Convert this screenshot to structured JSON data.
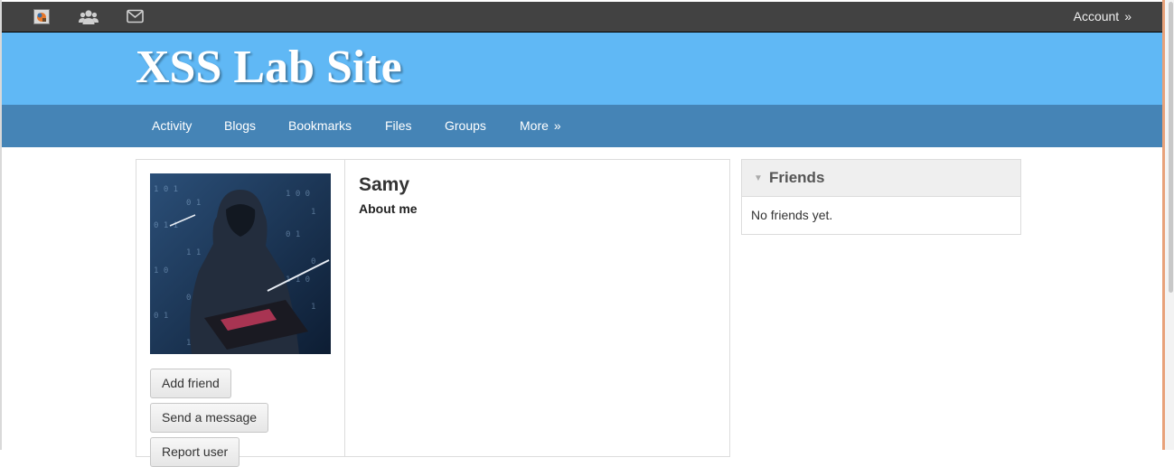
{
  "topbar": {
    "account_label": "Account",
    "account_arrow": "»",
    "icons": [
      "site-logo-icon",
      "friends-icon",
      "mail-icon"
    ]
  },
  "header": {
    "site_title": "XSS Lab Site"
  },
  "nav": {
    "items": [
      "Activity",
      "Blogs",
      "Bookmarks",
      "Files",
      "Groups",
      "More"
    ],
    "more_arrow": "»"
  },
  "profile": {
    "name": "Samy",
    "about_label": "About me",
    "buttons": [
      "Add friend",
      "Send a message",
      "Report user"
    ]
  },
  "friends": {
    "title": "Friends",
    "empty_text": "No friends yet."
  },
  "colors": {
    "topbar": "#424242",
    "header": "#60b8f5",
    "nav": "#4584b6"
  }
}
